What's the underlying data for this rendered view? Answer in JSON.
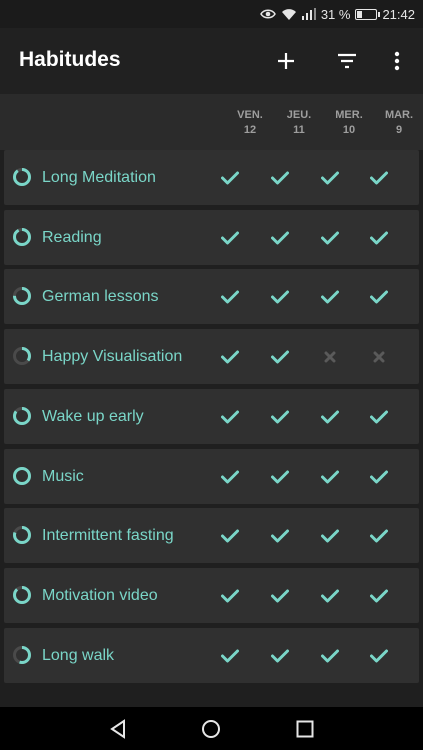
{
  "status_bar": {
    "battery_percent": "31 %",
    "battery_level": 0.31,
    "time": "21:42",
    "icons": [
      "eye-icon",
      "wifi-icon",
      "signal-icon",
      "battery-icon"
    ]
  },
  "app_bar": {
    "title": "Habitudes",
    "actions": [
      "add-icon",
      "filter-icon",
      "more-vert-icon"
    ]
  },
  "days": [
    {
      "weekday": "VEN.",
      "date": "12"
    },
    {
      "weekday": "JEU.",
      "date": "11"
    },
    {
      "weekday": "MER.",
      "date": "10"
    },
    {
      "weekday": "MAR.",
      "date": "9"
    }
  ],
  "colors": {
    "accent": "#7ad6c8",
    "check": "#7ad6c8",
    "cross": "#5a5a5a",
    "ring_track": "#4a4a4a",
    "row_bg": "#303030",
    "app_bg": "#1f1f1f"
  },
  "habits": [
    {
      "name": "Long Meditation",
      "score": 0.9,
      "checks": [
        true,
        true,
        true,
        true
      ]
    },
    {
      "name": "Reading",
      "score": 0.92,
      "checks": [
        true,
        true,
        true,
        true
      ]
    },
    {
      "name": "German lessons",
      "score": 0.75,
      "checks": [
        true,
        true,
        true,
        true
      ]
    },
    {
      "name": "Happy Visualisation",
      "score": 0.35,
      "checks": [
        true,
        true,
        false,
        false
      ]
    },
    {
      "name": "Wake up early",
      "score": 0.85,
      "checks": [
        true,
        true,
        true,
        true
      ]
    },
    {
      "name": "Music",
      "score": 1.0,
      "checks": [
        true,
        true,
        true,
        true
      ]
    },
    {
      "name": "Intermittent fasting",
      "score": 0.8,
      "checks": [
        true,
        true,
        true,
        true
      ]
    },
    {
      "name": "Motivation video",
      "score": 0.88,
      "checks": [
        true,
        true,
        true,
        true
      ]
    },
    {
      "name": "Long walk",
      "score": 0.55,
      "checks": [
        true,
        true,
        true,
        true
      ]
    }
  ],
  "nav_bar": {
    "buttons": [
      "back-icon",
      "home-icon",
      "recents-icon"
    ]
  }
}
